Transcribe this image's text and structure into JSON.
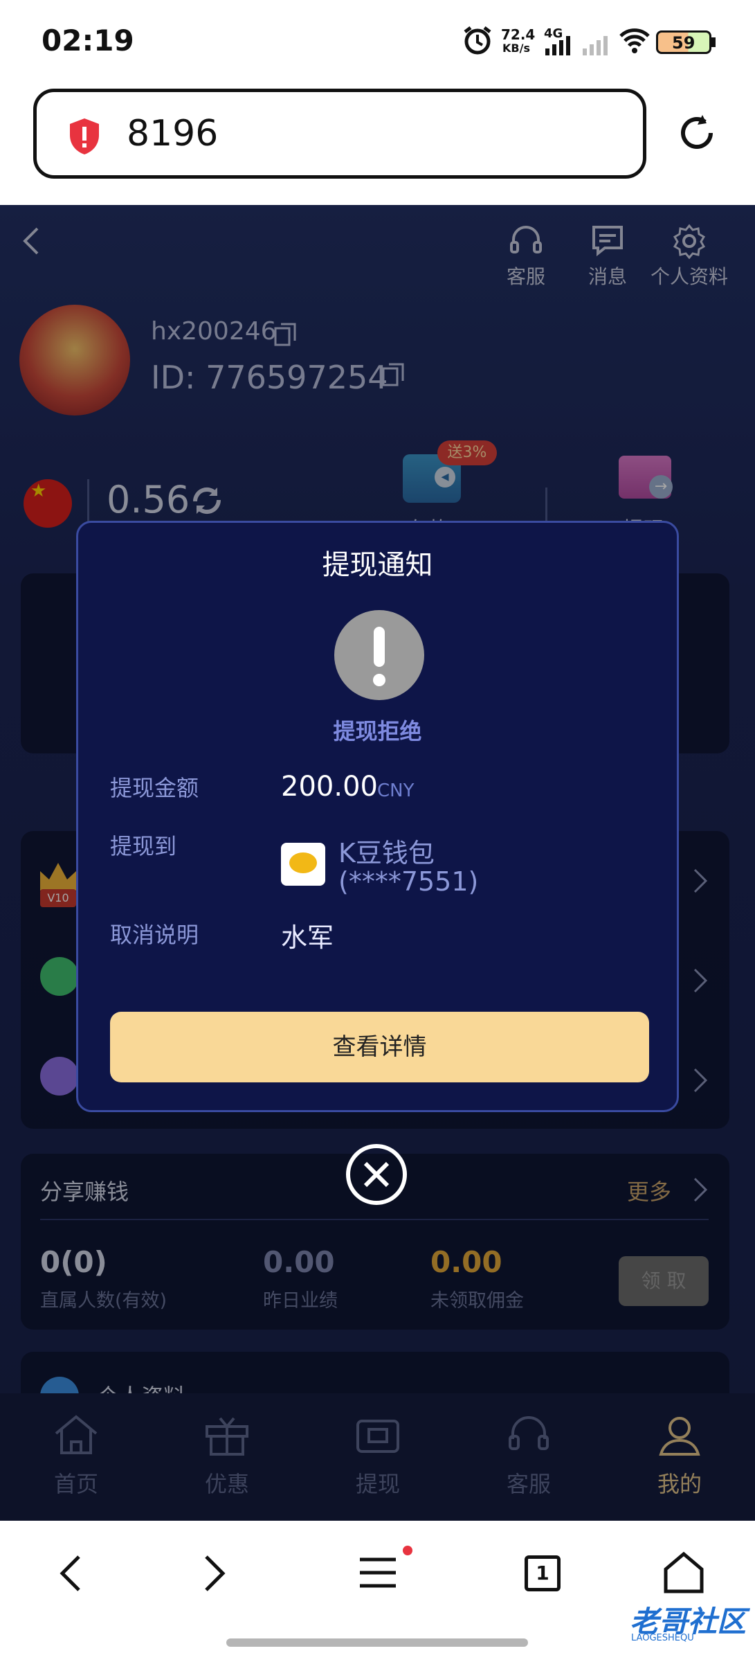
{
  "status_bar": {
    "time": "02:19",
    "net_speed_top": "72.4",
    "net_speed_unit": "KB/s",
    "network": "4G",
    "battery": "59"
  },
  "browser": {
    "url": "8196"
  },
  "header": {
    "service_label": "客服",
    "message_label": "消息",
    "profile_label": "个人资料"
  },
  "user": {
    "username": "hx200246",
    "id": "ID: 776597254"
  },
  "balance": {
    "amount": "0.56",
    "deposit_label": "存款",
    "deposit_badge": "送3%",
    "withdraw_label": "提现"
  },
  "share": {
    "title": "分享赚钱",
    "more": "更多",
    "stats": [
      {
        "value": "0(0)",
        "label": "直属人数(有效)"
      },
      {
        "value": "0.00",
        "label": "昨日业绩"
      },
      {
        "value": "0.00",
        "label": "未领取佣金"
      }
    ],
    "claim_button": "领 取"
  },
  "partial_row": "个人资料",
  "vip_badge": "V10",
  "bottom_nav": [
    {
      "label": "首页",
      "icon": "home-icon"
    },
    {
      "label": "优惠",
      "icon": "gift-icon"
    },
    {
      "label": "提现",
      "icon": "wallet-icon"
    },
    {
      "label": "客服",
      "icon": "headset-icon"
    },
    {
      "label": "我的",
      "icon": "user-icon"
    }
  ],
  "dialog": {
    "title": "提现通知",
    "status": "提现拒绝",
    "amount_label": "提现金额",
    "amount": "200.00",
    "currency": "CNY",
    "to_label": "提现到",
    "wallet_name": "K豆钱包",
    "wallet_account": "(****7551)",
    "reason_label": "取消说明",
    "reason": "水军",
    "button": "查看详情"
  },
  "browser_toolbar": {
    "tabs_count": "1"
  },
  "watermark": {
    "text": "老哥社区",
    "sub": "LAOGESHEQU"
  },
  "colors": {
    "accent_gold": "#f9d897",
    "dialog_bg": "#0e1548",
    "status_text": "#8c98d8",
    "app_bg": "#1c2554"
  }
}
